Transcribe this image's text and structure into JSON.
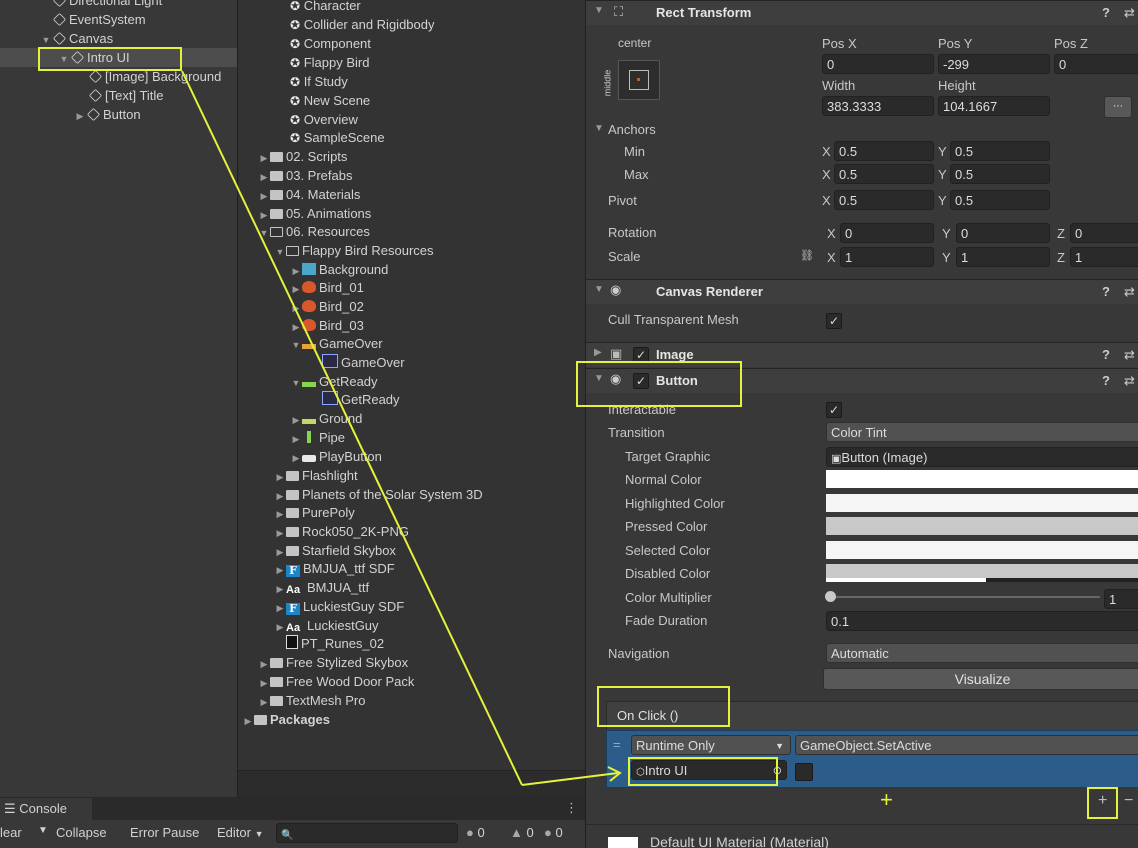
{
  "hierarchy": {
    "items": [
      "Directional Light",
      "EventSystem",
      "Canvas",
      "Intro UI",
      "[Image] Background",
      "[Text] Title",
      "Button"
    ]
  },
  "project": {
    "scenes": [
      "Character",
      "Collider and Rigidbody",
      "Component",
      "Flappy Bird",
      "If Study",
      "New Scene",
      "Overview",
      "SampleScene"
    ],
    "folders_top": [
      "02. Scripts",
      "03. Prefabs",
      "04. Materials",
      "05. Animations",
      "06. Resources"
    ],
    "flappy": "Flappy Bird Resources",
    "flappy_items": [
      "Background",
      "Bird_01",
      "Bird_02",
      "Bird_03",
      "GameOver",
      "GameOver",
      "GetReady",
      "GetReady",
      "Ground",
      "Pipe",
      "PlayButton"
    ],
    "res_items": [
      "Flashlight",
      "Planets of the Solar System 3D",
      "PurePoly",
      "Rock050_2K-PNG",
      "Starfield Skybox",
      "BMJUA_ttf SDF",
      "BMJUA_ttf",
      "LuckiestGuy SDF",
      "LuckiestGuy",
      "PT_Runes_02"
    ],
    "folders_bottom": [
      "Free Stylized Skybox",
      "Free Wood Door Pack",
      "TextMesh Pro"
    ],
    "packages": "Packages"
  },
  "inspector": {
    "rect_title": "Rect Transform",
    "anchor_preset": "center",
    "anchor_side": "middle",
    "pos_labels": [
      "Pos X",
      "Pos Y",
      "Pos Z"
    ],
    "pos_values": [
      "0",
      "-299",
      "0"
    ],
    "size_labels": [
      "Width",
      "Height"
    ],
    "size_values": [
      "383.3333",
      "104.1667"
    ],
    "anchors": "Anchors",
    "min": "Min",
    "max": "Max",
    "pivot": "Pivot",
    "x": "X",
    "y": "Y",
    "z": "Z",
    "min_values": [
      "0.5",
      "0.5"
    ],
    "max_values": [
      "0.5",
      "0.5"
    ],
    "pivot_values": [
      "0.5",
      "0.5"
    ],
    "rotation": "Rotation",
    "rotation_values": [
      "0",
      "0",
      "0"
    ],
    "scale": "Scale",
    "scale_values": [
      "1",
      "1",
      "1"
    ],
    "canvas_renderer": "Canvas Renderer",
    "cull": "Cull Transparent Mesh",
    "image": "Image",
    "button": "Button",
    "interactable": "Interactable",
    "transition": "Transition",
    "transition_value": "Color Tint",
    "target_graphic": "Target Graphic",
    "target_graphic_value": "Button (Image)",
    "colors": [
      "Normal Color",
      "Highlighted Color",
      "Pressed Color",
      "Selected Color",
      "Disabled Color"
    ],
    "color_values": [
      "#ffffff",
      "#f5f5f5",
      "#c8c8c8",
      "#f5f5f5",
      "#c8c8c8"
    ],
    "color_multiplier": "Color Multiplier",
    "color_multiplier_value": "1",
    "fade_duration": "Fade Duration",
    "fade_value": "0.1",
    "navigation": "Navigation",
    "navigation_value": "Automatic",
    "visualize": "Visualize",
    "onclick": "On Click ()",
    "runtime": "Runtime Only",
    "function": "GameObject.SetActive",
    "object": "Intro UI",
    "material": "Default UI Material (Material)"
  },
  "console": {
    "tab": "Console",
    "clear": "lear",
    "collapse": "Collapse",
    "error_pause": "Error Pause",
    "editor": "Editor",
    "counts": [
      "0",
      "0",
      "0"
    ]
  },
  "colors": {
    "highlight": "#e5f23a",
    "event_bg": "#2c5d8a",
    "selection": "#4d4d4d"
  }
}
